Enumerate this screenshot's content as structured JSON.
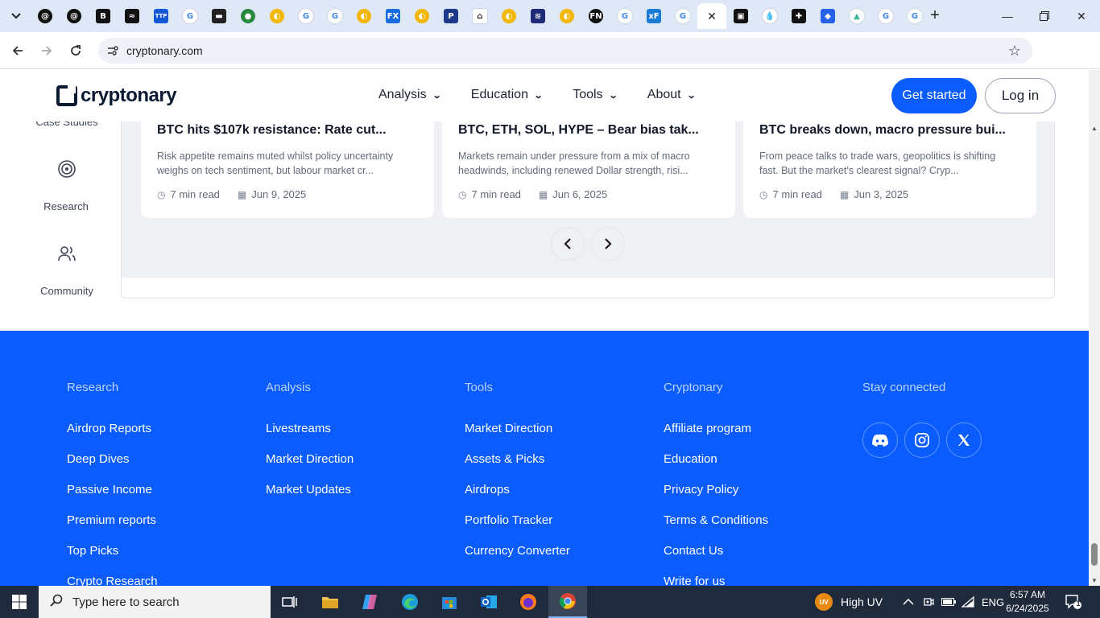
{
  "browser": {
    "tabs": [
      {
        "name": "tab-threads-1",
        "glyph": "@",
        "bg": "#111111",
        "shape": "round"
      },
      {
        "name": "tab-threads-2",
        "glyph": "@",
        "bg": "#111111",
        "shape": "round"
      },
      {
        "name": "tab-b",
        "glyph": "B",
        "bg": "#111111",
        "shape": "sq"
      },
      {
        "name": "tab-chart",
        "glyph": "≈",
        "bg": "#111111",
        "shape": "sq"
      },
      {
        "name": "tab-ttp",
        "glyph": "TTP",
        "bg": "#1558d6",
        "shape": "sq"
      },
      {
        "name": "tab-google-1",
        "glyph": "G",
        "bg": "#ffffff",
        "shape": "round",
        "fg": "#4285f4"
      },
      {
        "name": "tab-dark",
        "glyph": "▬",
        "bg": "#222222",
        "shape": "sq"
      },
      {
        "name": "tab-green",
        "glyph": "●",
        "bg": "#2b8a3e",
        "shape": "round"
      },
      {
        "name": "tab-yellow-1",
        "glyph": "◐",
        "bg": "#f2b705",
        "shape": "round"
      },
      {
        "name": "tab-google-2",
        "glyph": "G",
        "bg": "#ffffff",
        "shape": "round",
        "fg": "#4285f4"
      },
      {
        "name": "tab-google-3",
        "glyph": "G",
        "bg": "#ffffff",
        "shape": "round",
        "fg": "#4285f4"
      },
      {
        "name": "tab-yellow-2",
        "glyph": "◐",
        "bg": "#f2b705",
        "shape": "round"
      },
      {
        "name": "tab-fx",
        "glyph": "FX",
        "bg": "#1a6ae0",
        "shape": "sq"
      },
      {
        "name": "tab-yellow-3",
        "glyph": "◐",
        "bg": "#f2b705",
        "shape": "round"
      },
      {
        "name": "tab-p",
        "glyph": "P",
        "bg": "#1e3a8a",
        "shape": "sq"
      },
      {
        "name": "tab-house",
        "glyph": "⌂",
        "bg": "#ffffff",
        "shape": "sq",
        "fg": "#222"
      },
      {
        "name": "tab-yellow-4",
        "glyph": "◐",
        "bg": "#f2b705",
        "shape": "round"
      },
      {
        "name": "tab-wave",
        "glyph": "≋",
        "bg": "#1e2a78",
        "shape": "sq"
      },
      {
        "name": "tab-yellow-5",
        "glyph": "◐",
        "bg": "#f2b705",
        "shape": "round"
      },
      {
        "name": "tab-fn",
        "glyph": "FN",
        "bg": "#111111",
        "shape": "round"
      },
      {
        "name": "tab-google-4",
        "glyph": "G",
        "bg": "#ffffff",
        "shape": "round",
        "fg": "#4285f4"
      },
      {
        "name": "tab-xf",
        "glyph": "xF",
        "bg": "#1a7bd6",
        "shape": "sq"
      },
      {
        "name": "tab-google-5",
        "glyph": "G",
        "bg": "#ffffff",
        "shape": "round",
        "fg": "#4285f4"
      },
      {
        "name": "tab-active",
        "glyph": "✕",
        "active": true
      },
      {
        "name": "tab-cryptonary-2",
        "glyph": "▣",
        "bg": "#111111",
        "shape": "sq"
      },
      {
        "name": "tab-drop",
        "glyph": "💧",
        "bg": "#ffffff",
        "shape": "round",
        "fg": "#3b82f6"
      },
      {
        "name": "tab-plus",
        "glyph": "✚",
        "bg": "#111111",
        "shape": "sq"
      },
      {
        "name": "tab-shield",
        "glyph": "◆",
        "bg": "#2563eb",
        "shape": "sq"
      },
      {
        "name": "tab-triangle",
        "glyph": "▲",
        "bg": "#ffffff",
        "shape": "round",
        "fg": "#3bb59b"
      },
      {
        "name": "tab-google-6",
        "glyph": "G",
        "bg": "#ffffff",
        "shape": "round",
        "fg": "#4285f4"
      },
      {
        "name": "tab-google-7",
        "glyph": "G",
        "bg": "#ffffff",
        "shape": "round",
        "fg": "#4285f4"
      }
    ],
    "url": "cryptonary.com"
  },
  "site": {
    "logo_text": "cryptonary",
    "nav": [
      "Analysis",
      "Education",
      "Tools",
      "About"
    ],
    "get_started": "Get started",
    "login": "Log in"
  },
  "rail": {
    "case_studies": "Case Studies",
    "research": "Research",
    "community": "Community"
  },
  "cards": [
    {
      "title": "BTC hits $107k resistance: Rate cut...",
      "excerpt": "Risk appetite remains muted whilst policy uncertainty weighs on tech sentiment, but labour market cr...",
      "read": "7 min read",
      "date": "Jun 9, 2025"
    },
    {
      "title": "BTC, ETH, SOL, HYPE – Bear bias tak...",
      "excerpt": "Markets remain under pressure from a mix of macro headwinds, including renewed Dollar strength, risi...",
      "read": "7 min read",
      "date": "Jun 6, 2025"
    },
    {
      "title": "BTC breaks down, macro pressure bui...",
      "excerpt": "From peace talks to trade wars, geopolitics is shifting fast. But the market's clearest signal? Cryp...",
      "read": "7 min read",
      "date": "Jun 3, 2025"
    }
  ],
  "footer": {
    "columns": [
      {
        "heading": "Research",
        "links": [
          "Airdrop Reports",
          "Deep Dives",
          "Passive Income",
          "Premium reports",
          "Top Picks",
          "Crypto Research"
        ]
      },
      {
        "heading": "Analysis",
        "links": [
          "Livestreams",
          "Market Direction",
          "Market Updates"
        ]
      },
      {
        "heading": "Tools",
        "links": [
          "Market Direction",
          "Assets & Picks",
          "Airdrops",
          "Portfolio Tracker",
          "Currency Converter"
        ]
      },
      {
        "heading": "Cryptonary",
        "links": [
          "Affiliate program",
          "Education",
          "Privacy Policy",
          "Terms & Conditions",
          "Contact Us",
          "Write for us"
        ]
      }
    ],
    "stay_connected": "Stay connected",
    "socials": [
      "discord-icon",
      "instagram-icon",
      "x-icon"
    ]
  },
  "taskbar": {
    "search_placeholder": "Type here to search",
    "weather": "High UV",
    "uv_badge": "UV",
    "language": "ENG",
    "time": "6:57 AM",
    "date": "6/24/2025",
    "notif_count": "1"
  },
  "colors": {
    "brand_blue": "#0a5cff",
    "taskbar": "#1f2a3c"
  }
}
